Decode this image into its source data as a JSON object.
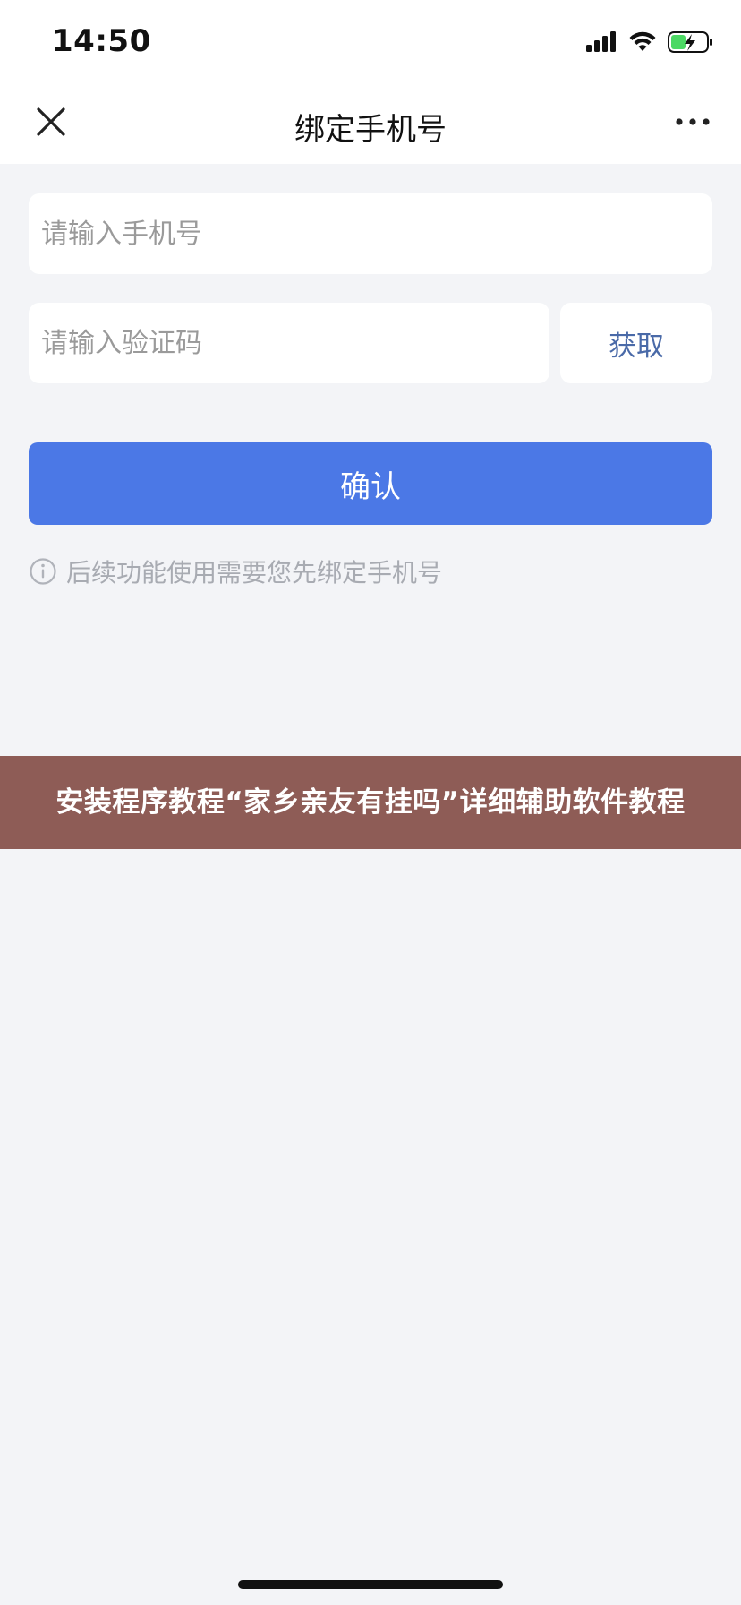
{
  "status_bar": {
    "time": "14:50",
    "icons": [
      "signal-icon",
      "wifi-icon",
      "battery-charging-icon"
    ]
  },
  "nav": {
    "title": "绑定手机号",
    "left_icon": "close-icon",
    "right_icon": "more-icon"
  },
  "form": {
    "phone_placeholder": "请输入手机号",
    "phone_value": "",
    "code_placeholder": "请输入验证码",
    "code_value": "",
    "get_code_label": "获取",
    "confirm_label": "确认",
    "hint_icon": "info-icon",
    "hint_text": "后续功能使用需要您先绑定手机号"
  },
  "banner": {
    "text": "安装程序教程“家乡亲友有挂吗”详细辅助软件教程"
  },
  "colors": {
    "background": "#f3f4f7",
    "accent": "#4b78e6",
    "link": "#4a6aa8",
    "banner": "#8e5c56",
    "battery_fill": "#4cd964"
  }
}
